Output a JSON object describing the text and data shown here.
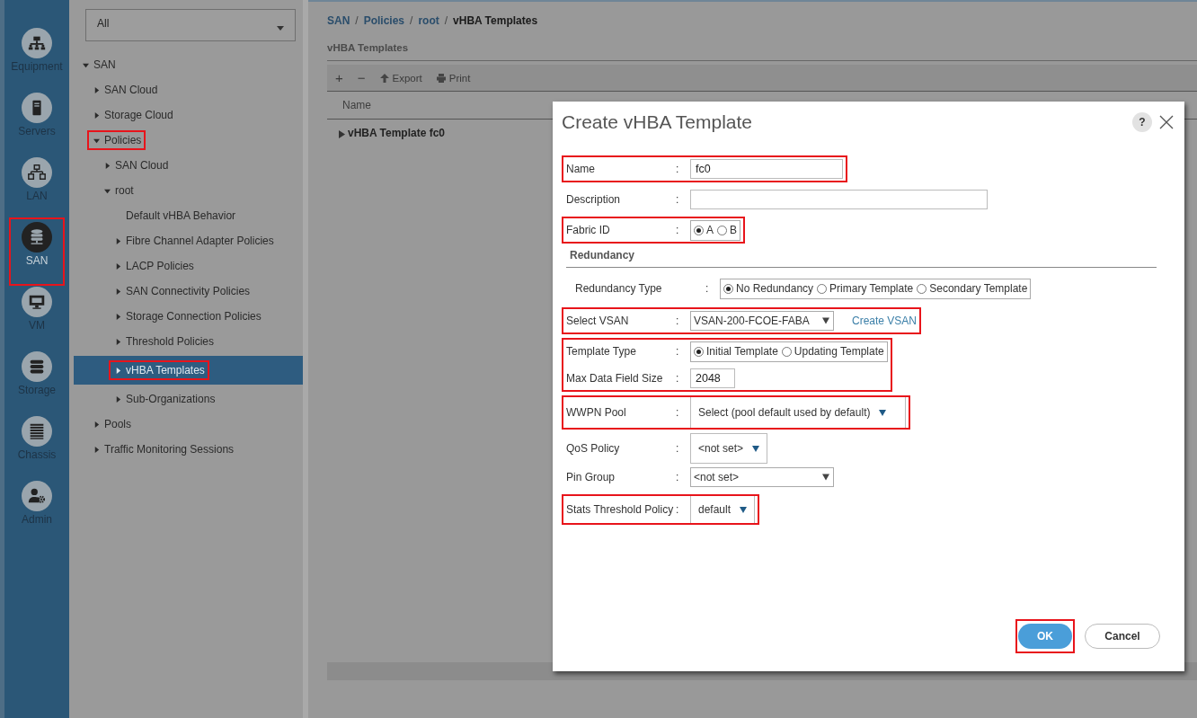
{
  "rail": [
    {
      "label": "Equipment",
      "selected": false,
      "highlighted": false
    },
    {
      "label": "Servers",
      "selected": false,
      "highlighted": false
    },
    {
      "label": "LAN",
      "selected": false,
      "highlighted": false
    },
    {
      "label": "SAN",
      "selected": true,
      "highlighted": true
    },
    {
      "label": "VM",
      "selected": false,
      "highlighted": false
    },
    {
      "label": "Storage",
      "selected": false,
      "highlighted": false
    },
    {
      "label": "Chassis",
      "selected": false,
      "highlighted": false
    },
    {
      "label": "Admin",
      "selected": false,
      "highlighted": false
    }
  ],
  "nav": {
    "filter": "All",
    "tree": [
      {
        "label": "SAN",
        "expanded": true,
        "selected": false,
        "highlighted": false,
        "children": [
          {
            "label": "SAN Cloud",
            "expanded": false,
            "selected": false,
            "highlighted": false
          },
          {
            "label": "Storage Cloud",
            "expanded": false,
            "selected": false,
            "highlighted": false
          },
          {
            "label": "Policies",
            "expanded": true,
            "selected": false,
            "highlighted": true,
            "children": [
              {
                "label": "SAN Cloud",
                "expanded": false,
                "selected": false,
                "highlighted": false
              },
              {
                "label": "root",
                "expanded": true,
                "selected": false,
                "highlighted": false,
                "children": [
                  {
                    "label": "Default vHBA Behavior",
                    "selected": false,
                    "highlighted": false
                  },
                  {
                    "label": "Fibre Channel Adapter Policies",
                    "expanded": false,
                    "selected": false,
                    "highlighted": false
                  },
                  {
                    "label": "LACP Policies",
                    "expanded": false,
                    "selected": false,
                    "highlighted": false
                  },
                  {
                    "label": "SAN Connectivity Policies",
                    "expanded": false,
                    "selected": false,
                    "highlighted": false
                  },
                  {
                    "label": "Storage Connection Policies",
                    "expanded": false,
                    "selected": false,
                    "highlighted": false
                  },
                  {
                    "label": "Threshold Policies",
                    "expanded": false,
                    "selected": false,
                    "highlighted": false
                  },
                  {
                    "label": "vHBA Templates",
                    "expanded": false,
                    "selected": true,
                    "highlighted": true
                  },
                  {
                    "label": "Sub-Organizations",
                    "expanded": false,
                    "selected": false,
                    "highlighted": false
                  }
                ]
              }
            ]
          },
          {
            "label": "Pools",
            "expanded": false,
            "selected": false,
            "highlighted": false
          },
          {
            "label": "Traffic Monitoring Sessions",
            "expanded": false,
            "selected": false,
            "highlighted": false
          }
        ]
      }
    ]
  },
  "breadcrumb": [
    {
      "kind": "link",
      "label": "SAN"
    },
    {
      "kind": "separator",
      "label": "/"
    },
    {
      "kind": "link",
      "label": "Policies"
    },
    {
      "kind": "separator",
      "label": "/"
    },
    {
      "kind": "link",
      "label": "root"
    },
    {
      "kind": "separator",
      "label": "/"
    },
    {
      "kind": "current",
      "label": "vHBA Templates"
    }
  ],
  "panel_title": "vHBA Templates",
  "toolbar": [
    {
      "kind": "add",
      "label": "+"
    },
    {
      "kind": "remove",
      "label": "−"
    },
    {
      "kind": "export",
      "label": "Export"
    },
    {
      "kind": "print",
      "label": "Print"
    }
  ],
  "table": {
    "columns": [
      "Name"
    ],
    "rows": [
      {
        "name": "vHBA Template fc0",
        "expanded": false
      }
    ]
  },
  "dialog": {
    "title": "Create vHBA Template",
    "help": "?",
    "groups": [
      {
        "highlighted": true,
        "rows": [
          {
            "kind": "text",
            "label": "Name",
            "colon": ":",
            "value": "fc0"
          }
        ]
      },
      {
        "highlighted": false,
        "rows": [
          {
            "kind": "text",
            "label": "Description",
            "colon": ":"
          }
        ]
      },
      {
        "highlighted": true,
        "rows": [
          {
            "kind": "radio",
            "label": "Fabric ID",
            "colon": ":",
            "options": [
              {
                "label": "A",
                "selected": true
              },
              {
                "label": "B",
                "selected": false
              }
            ]
          }
        ]
      },
      {
        "highlighted": false,
        "rows": [
          {
            "kind": "section",
            "label": "Redundancy",
            "children": [
              {
                "kind": "radio",
                "label": "Redundancy Type",
                "colon": ":",
                "options": [
                  {
                    "label": "No Redundancy",
                    "selected": true
                  },
                  {
                    "label": "Primary Template",
                    "selected": false
                  },
                  {
                    "label": "Secondary Template",
                    "selected": false
                  }
                ]
              }
            ]
          }
        ]
      },
      {
        "highlighted": true,
        "rows": [
          {
            "kind": "combo",
            "label": "Select VSAN",
            "colon": ":",
            "value": "VSAN-200-FCOE-FABA",
            "link": "Create VSAN"
          }
        ]
      },
      {
        "highlighted": true,
        "rows": [
          {
            "kind": "radio",
            "label": "Template Type",
            "colon": ":",
            "options": [
              {
                "label": "Initial Template",
                "selected": true
              },
              {
                "label": "Updating Template",
                "selected": false
              }
            ]
          },
          {
            "kind": "text",
            "label": "Max Data Field Size",
            "colon": ":",
            "value": "2048"
          }
        ]
      },
      {
        "highlighted": true,
        "rows": [
          {
            "kind": "dropdown",
            "label": "WWPN Pool",
            "colon": ":",
            "value": "Select (pool default used by default)"
          }
        ]
      },
      {
        "highlighted": false,
        "rows": [
          {
            "kind": "dropdown",
            "label": "QoS Policy",
            "colon": ":",
            "value": "<not set>"
          },
          {
            "kind": "combo",
            "label": "Pin Group",
            "colon": ":",
            "value": "<not set>"
          }
        ]
      },
      {
        "highlighted": true,
        "rows": [
          {
            "kind": "dropdown",
            "label": "Stats Threshold Policy",
            "colon": ":",
            "value": "default"
          }
        ]
      }
    ],
    "buttons": [
      {
        "label": "OK",
        "kind": "primary",
        "highlighted": true
      },
      {
        "label": "Cancel",
        "kind": "secondary",
        "highlighted": false
      }
    ]
  }
}
